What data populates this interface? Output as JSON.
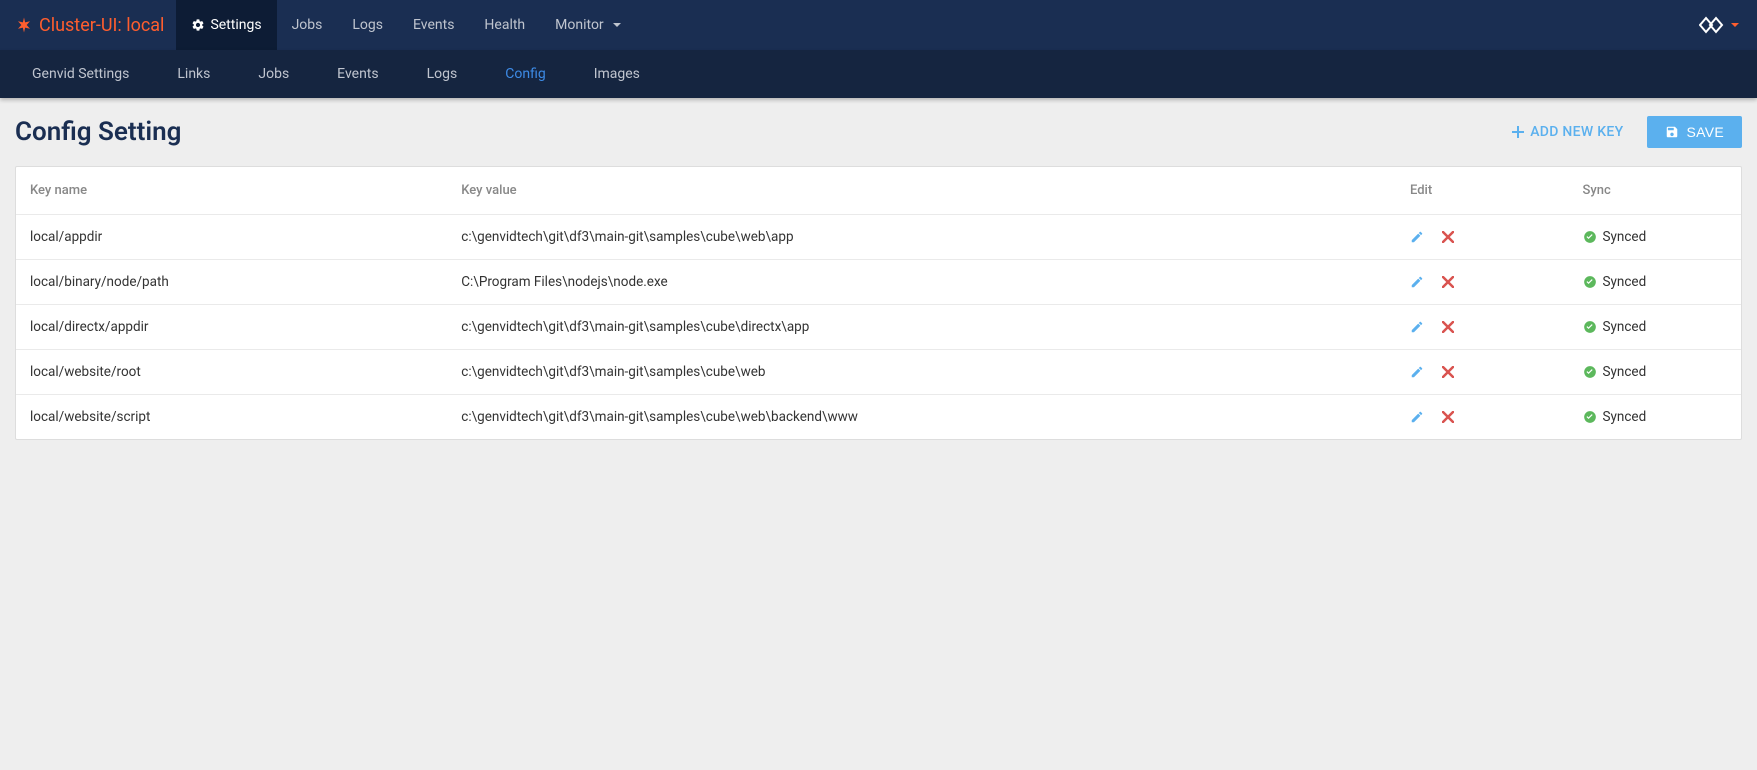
{
  "brand": "Cluster-UI: local",
  "topNav": [
    {
      "label": "Settings",
      "active": true,
      "icon": "gear"
    },
    {
      "label": "Jobs"
    },
    {
      "label": "Logs"
    },
    {
      "label": "Events"
    },
    {
      "label": "Health"
    },
    {
      "label": "Monitor",
      "caret": true
    }
  ],
  "subNav": [
    {
      "label": "Genvid Settings"
    },
    {
      "label": "Links"
    },
    {
      "label": "Jobs"
    },
    {
      "label": "Events"
    },
    {
      "label": "Logs"
    },
    {
      "label": "Config",
      "active": true
    },
    {
      "label": "Images"
    }
  ],
  "pageTitle": "Config Setting",
  "actions": {
    "addNewKey": "ADD NEW KEY",
    "save": "SAVE"
  },
  "table": {
    "headers": {
      "key": "Key name",
      "value": "Key value",
      "edit": "Edit",
      "sync": "Sync"
    },
    "rows": [
      {
        "key": "local/appdir",
        "value": "c:\\genvidtech\\git\\df3\\main-git\\samples\\cube\\web\\app",
        "sync": "Synced"
      },
      {
        "key": "local/binary/node/path",
        "value": "C:\\Program Files\\nodejs\\node.exe",
        "sync": "Synced"
      },
      {
        "key": "local/directx/appdir",
        "value": "c:\\genvidtech\\git\\df3\\main-git\\samples\\cube\\directx\\app",
        "sync": "Synced"
      },
      {
        "key": "local/website/root",
        "value": "c:\\genvidtech\\git\\df3\\main-git\\samples\\cube\\web",
        "sync": "Synced"
      },
      {
        "key": "local/website/script",
        "value": "c:\\genvidtech\\git\\df3\\main-git\\samples\\cube\\web\\backend\\www",
        "sync": "Synced"
      }
    ]
  }
}
